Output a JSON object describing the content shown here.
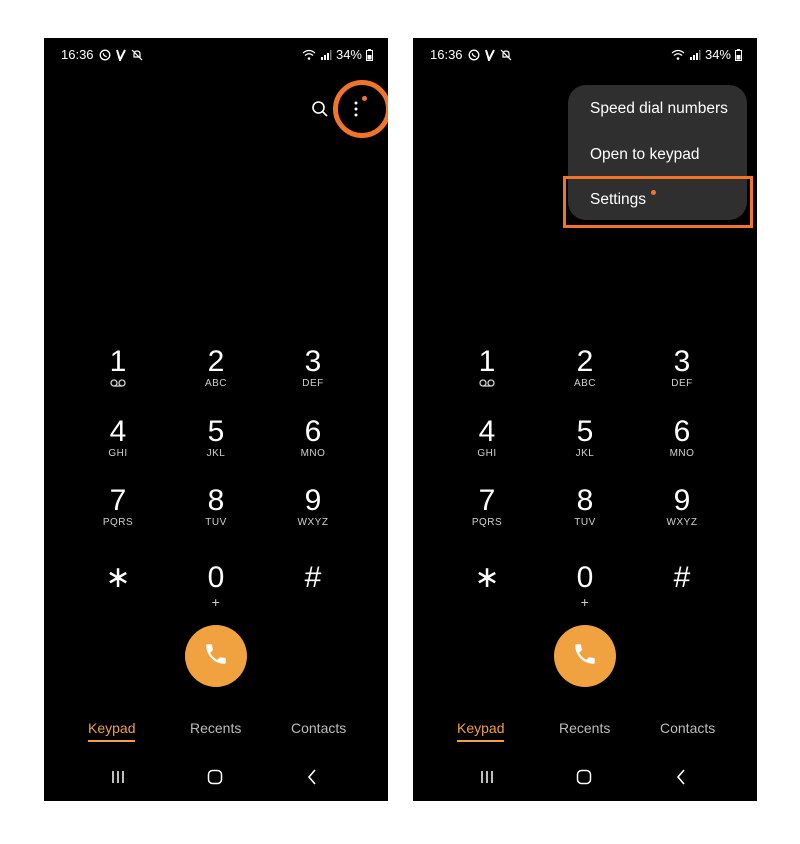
{
  "status_bar": {
    "time": "16:36",
    "battery": "34%"
  },
  "keys": [
    {
      "digit": "1",
      "letters": "",
      "voicemail": true
    },
    {
      "digit": "2",
      "letters": "ABC"
    },
    {
      "digit": "3",
      "letters": "DEF"
    },
    {
      "digit": "4",
      "letters": "GHI"
    },
    {
      "digit": "5",
      "letters": "JKL"
    },
    {
      "digit": "6",
      "letters": "MNO"
    },
    {
      "digit": "7",
      "letters": "PQRS"
    },
    {
      "digit": "8",
      "letters": "TUV"
    },
    {
      "digit": "9",
      "letters": "WXYZ"
    },
    {
      "digit": "∗",
      "letters": ""
    },
    {
      "digit": "0",
      "letters": "+"
    },
    {
      "digit": "#",
      "letters": ""
    }
  ],
  "tabs": {
    "keypad": "Keypad",
    "recents": "Recents",
    "contacts": "Contacts"
  },
  "menu": {
    "speed_dial": "Speed dial numbers",
    "open_keypad": "Open to keypad",
    "settings": "Settings"
  },
  "colors": {
    "accent": "#f0752b",
    "call_button": "#f0a140",
    "background": "#000000",
    "menu_background": "#2f2f2f"
  },
  "icons": [
    "search-icon",
    "more-options-icon",
    "phone-icon",
    "voicemail-icon",
    "recent-apps-icon",
    "home-icon",
    "back-icon"
  ]
}
